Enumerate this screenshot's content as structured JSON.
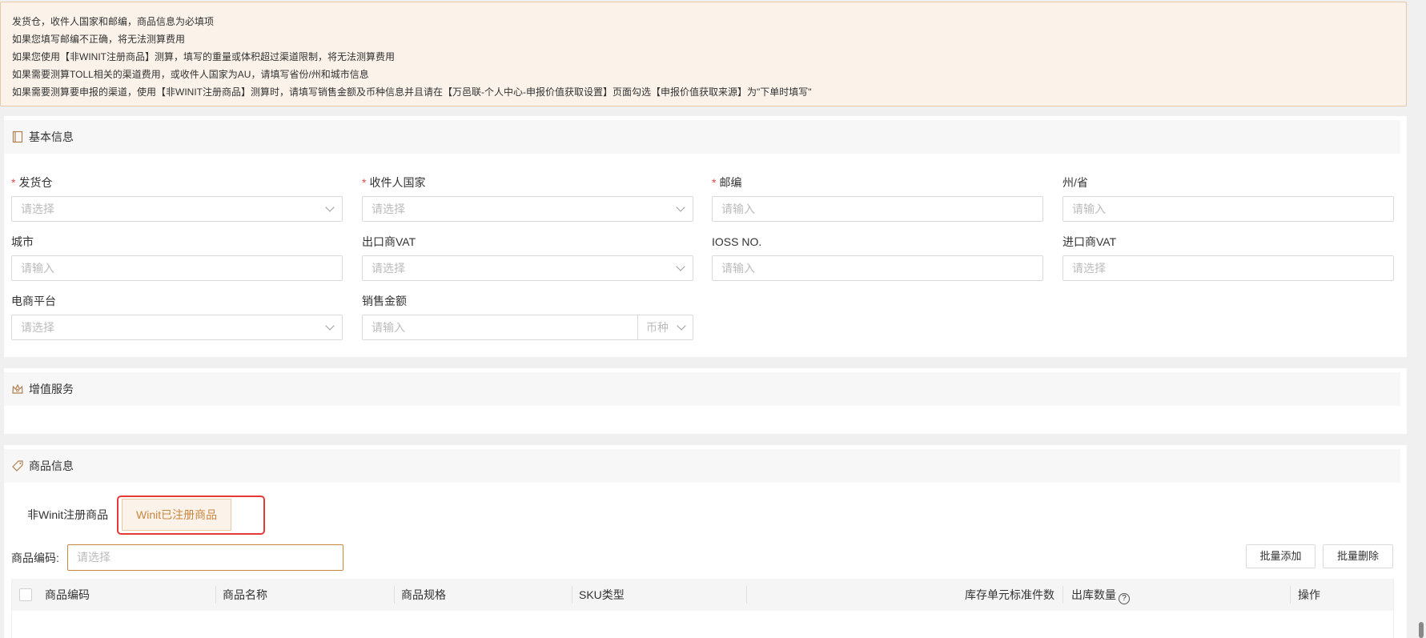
{
  "notice": {
    "lines": [
      "发货仓，收件人国家和邮编，商品信息为必填项",
      "如果您填写邮编不正确，将无法测算费用",
      "如果您使用【非WINIT注册商品】测算，填写的重量或体积超过渠道限制，将无法测算费用",
      "如果需要测算TOLL相关的渠道费用，或收件人国家为AU，请填写省份/州和城市信息",
      "如果需要测算要申报的渠道，使用【非WINIT注册商品】测算时，请填写销售金额及币种信息并且请在【万邑联-个人中心-申报价值获取设置】页面勾选【申报价值获取来源】为\"下单时填写\""
    ]
  },
  "basic": {
    "title": "基本信息",
    "warehouse": {
      "label": "发货仓",
      "placeholder": "请选择"
    },
    "country": {
      "label": "收件人国家",
      "placeholder": "请选择"
    },
    "postcode": {
      "label": "邮编",
      "placeholder": "请输入"
    },
    "state": {
      "label": "州/省",
      "placeholder": "请输入"
    },
    "city": {
      "label": "城市",
      "placeholder": "请输入"
    },
    "exporter_vat": {
      "label": "出口商VAT",
      "placeholder": "请选择"
    },
    "ioss": {
      "label": "IOSS NO.",
      "placeholder": "请输入"
    },
    "importer_vat": {
      "label": "进口商VAT",
      "placeholder": "请选择"
    },
    "platform": {
      "label": "电商平台",
      "placeholder": "请选择"
    },
    "sales_amount": {
      "label": "销售金额",
      "placeholder": "请输入",
      "currency_placeholder": "币种"
    }
  },
  "value_added": {
    "title": "增值服务"
  },
  "goods": {
    "title": "商品信息",
    "tabs": [
      "非Winit注册商品",
      "Winit已注册商品"
    ],
    "active_tab": 1,
    "code_label": "商品编码:",
    "code_placeholder": "请选择",
    "batch_add": "批量添加",
    "batch_delete": "批量删除",
    "columns": [
      "商品编码",
      "商品名称",
      "商品规格",
      "SKU类型",
      "库存单元标准件数",
      "出库数量",
      "操作"
    ]
  },
  "colors": {
    "accent": "#c8863f",
    "highlight_red": "#e53935",
    "required": "#e5473f",
    "notice_bg": "#fbf3ea"
  }
}
